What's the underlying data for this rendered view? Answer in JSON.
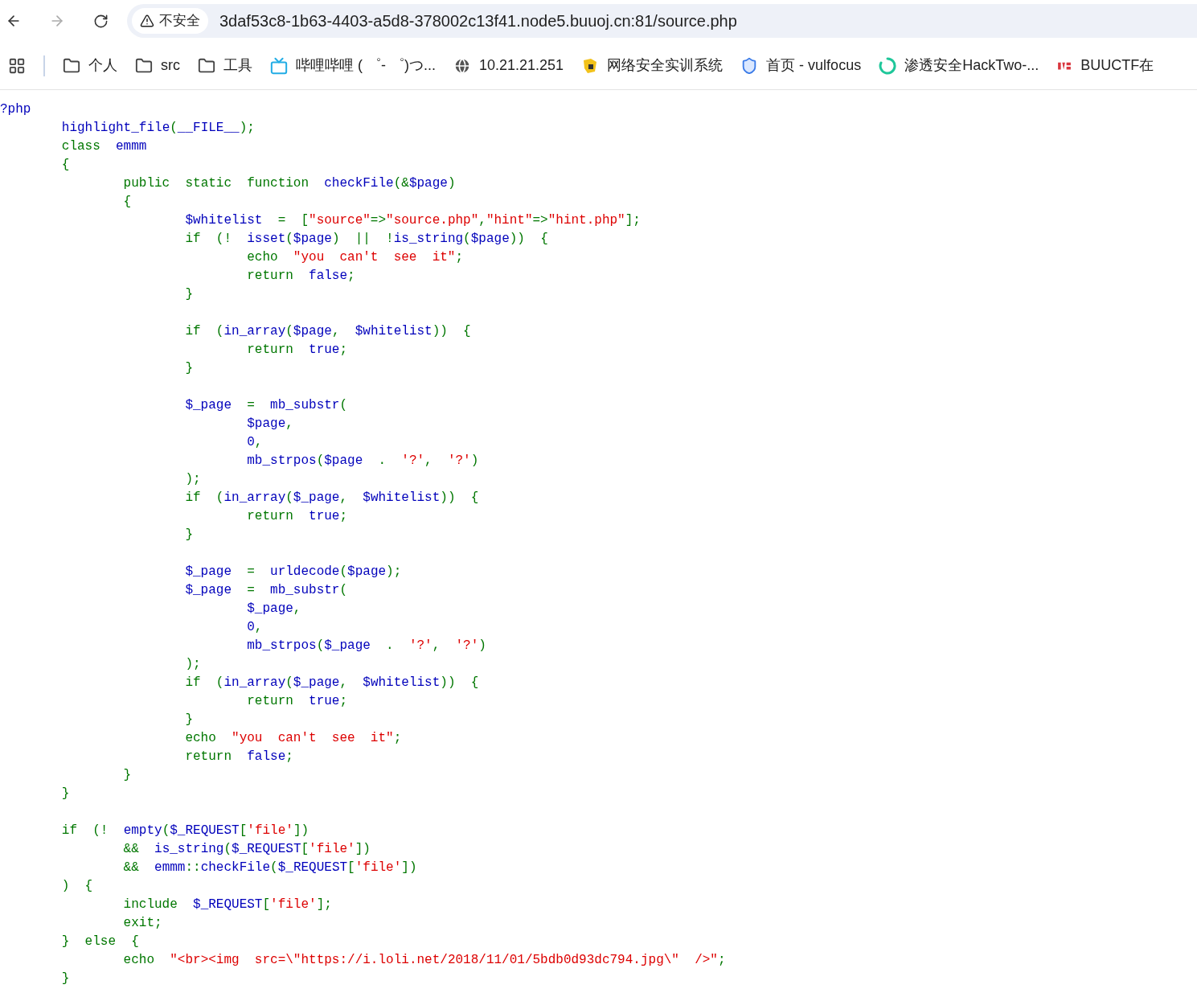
{
  "toolbar": {
    "security_label": "不安全",
    "url": "3daf53c8-1b63-4403-a5d8-378002c13f41.node5.buuoj.cn:81/source.php"
  },
  "bookmarks": [
    {
      "kind": "folder",
      "label": "个人"
    },
    {
      "kind": "folder",
      "label": "src"
    },
    {
      "kind": "folder",
      "label": "工具"
    },
    {
      "kind": "tv",
      "label": "哔哩哔哩 ( ゜- ゜)つ..."
    },
    {
      "kind": "globe",
      "label": "10.21.21.251"
    },
    {
      "kind": "badge",
      "label": "网络安全实训系统"
    },
    {
      "kind": "shield",
      "label": "首页 - vulfocus"
    },
    {
      "kind": "ring",
      "label": "渗透安全HackTwo-..."
    },
    {
      "kind": "logo",
      "label": "BUUCTF在"
    }
  ],
  "code": {
    "lines": [
      {
        "kind": "code",
        "tokens": [
          {
            "kind": "default",
            "text": "?php"
          }
        ]
      },
      {
        "kind": "code",
        "tokens": [
          {
            "kind": "default",
            "text": "    highlight_file"
          },
          {
            "kind": "keyword",
            "text": "("
          },
          {
            "kind": "default",
            "text": "__FILE__"
          },
          {
            "kind": "keyword",
            "text": ");"
          }
        ]
      },
      {
        "kind": "code",
        "tokens": [
          {
            "kind": "keyword",
            "text": "    class "
          },
          {
            "kind": "default",
            "text": "emmm"
          }
        ]
      },
      {
        "kind": "code",
        "tokens": [
          {
            "kind": "keyword",
            "text": "    {"
          }
        ]
      },
      {
        "kind": "code",
        "tokens": [
          {
            "kind": "keyword",
            "text": "        public static function "
          },
          {
            "kind": "default",
            "text": "checkFile"
          },
          {
            "kind": "keyword",
            "text": "(&"
          },
          {
            "kind": "default",
            "text": "$page"
          },
          {
            "kind": "keyword",
            "text": ")"
          }
        ]
      },
      {
        "kind": "code",
        "tokens": [
          {
            "kind": "keyword",
            "text": "        {"
          }
        ]
      },
      {
        "kind": "code",
        "tokens": [
          {
            "kind": "default",
            "text": "            $whitelist "
          },
          {
            "kind": "keyword",
            "text": "= ["
          },
          {
            "kind": "string",
            "text": "\"source\""
          },
          {
            "kind": "keyword",
            "text": "=>"
          },
          {
            "kind": "string",
            "text": "\"source.php\""
          },
          {
            "kind": "keyword",
            "text": ","
          },
          {
            "kind": "string",
            "text": "\"hint\""
          },
          {
            "kind": "keyword",
            "text": "=>"
          },
          {
            "kind": "string",
            "text": "\"hint.php\""
          },
          {
            "kind": "keyword",
            "text": "];"
          }
        ]
      },
      {
        "kind": "code",
        "tokens": [
          {
            "kind": "keyword",
            "text": "            if (! "
          },
          {
            "kind": "default",
            "text": "isset"
          },
          {
            "kind": "keyword",
            "text": "("
          },
          {
            "kind": "default",
            "text": "$page"
          },
          {
            "kind": "keyword",
            "text": ") || !"
          },
          {
            "kind": "default",
            "text": "is_string"
          },
          {
            "kind": "keyword",
            "text": "("
          },
          {
            "kind": "default",
            "text": "$page"
          },
          {
            "kind": "keyword",
            "text": ")) {"
          }
        ]
      },
      {
        "kind": "code",
        "tokens": [
          {
            "kind": "keyword",
            "text": "                echo "
          },
          {
            "kind": "string",
            "text": "\"you can't see it\""
          },
          {
            "kind": "keyword",
            "text": ";"
          }
        ]
      },
      {
        "kind": "code",
        "tokens": [
          {
            "kind": "keyword",
            "text": "                return "
          },
          {
            "kind": "default",
            "text": "false"
          },
          {
            "kind": "keyword",
            "text": ";"
          }
        ]
      },
      {
        "kind": "code",
        "tokens": [
          {
            "kind": "keyword",
            "text": "            }"
          }
        ]
      },
      {
        "kind": "blank"
      },
      {
        "kind": "code",
        "tokens": [
          {
            "kind": "keyword",
            "text": "            if ("
          },
          {
            "kind": "default",
            "text": "in_array"
          },
          {
            "kind": "keyword",
            "text": "("
          },
          {
            "kind": "default",
            "text": "$page"
          },
          {
            "kind": "keyword",
            "text": ", "
          },
          {
            "kind": "default",
            "text": "$whitelist"
          },
          {
            "kind": "keyword",
            "text": ")) {"
          }
        ]
      },
      {
        "kind": "code",
        "tokens": [
          {
            "kind": "keyword",
            "text": "                return "
          },
          {
            "kind": "default",
            "text": "true"
          },
          {
            "kind": "keyword",
            "text": ";"
          }
        ]
      },
      {
        "kind": "code",
        "tokens": [
          {
            "kind": "keyword",
            "text": "            }"
          }
        ]
      },
      {
        "kind": "blank"
      },
      {
        "kind": "code",
        "tokens": [
          {
            "kind": "default",
            "text": "            $_page "
          },
          {
            "kind": "keyword",
            "text": "= "
          },
          {
            "kind": "default",
            "text": "mb_substr"
          },
          {
            "kind": "keyword",
            "text": "("
          }
        ]
      },
      {
        "kind": "code",
        "tokens": [
          {
            "kind": "default",
            "text": "                $page"
          },
          {
            "kind": "keyword",
            "text": ","
          }
        ]
      },
      {
        "kind": "code",
        "tokens": [
          {
            "kind": "default",
            "text": "                0"
          },
          {
            "kind": "keyword",
            "text": ","
          }
        ]
      },
      {
        "kind": "code",
        "tokens": [
          {
            "kind": "default",
            "text": "                mb_strpos"
          },
          {
            "kind": "keyword",
            "text": "("
          },
          {
            "kind": "default",
            "text": "$page "
          },
          {
            "kind": "keyword",
            "text": ". "
          },
          {
            "kind": "string",
            "text": "'?'"
          },
          {
            "kind": "keyword",
            "text": ", "
          },
          {
            "kind": "string",
            "text": "'?'"
          },
          {
            "kind": "keyword",
            "text": ")"
          }
        ]
      },
      {
        "kind": "code",
        "tokens": [
          {
            "kind": "keyword",
            "text": "            );"
          }
        ]
      },
      {
        "kind": "code",
        "tokens": [
          {
            "kind": "keyword",
            "text": "            if ("
          },
          {
            "kind": "default",
            "text": "in_array"
          },
          {
            "kind": "keyword",
            "text": "("
          },
          {
            "kind": "default",
            "text": "$_page"
          },
          {
            "kind": "keyword",
            "text": ", "
          },
          {
            "kind": "default",
            "text": "$whitelist"
          },
          {
            "kind": "keyword",
            "text": ")) {"
          }
        ]
      },
      {
        "kind": "code",
        "tokens": [
          {
            "kind": "keyword",
            "text": "                return "
          },
          {
            "kind": "default",
            "text": "true"
          },
          {
            "kind": "keyword",
            "text": ";"
          }
        ]
      },
      {
        "kind": "code",
        "tokens": [
          {
            "kind": "keyword",
            "text": "            }"
          }
        ]
      },
      {
        "kind": "blank"
      },
      {
        "kind": "code",
        "tokens": [
          {
            "kind": "default",
            "text": "            $_page "
          },
          {
            "kind": "keyword",
            "text": "= "
          },
          {
            "kind": "default",
            "text": "urldecode"
          },
          {
            "kind": "keyword",
            "text": "("
          },
          {
            "kind": "default",
            "text": "$page"
          },
          {
            "kind": "keyword",
            "text": ");"
          }
        ]
      },
      {
        "kind": "code",
        "tokens": [
          {
            "kind": "default",
            "text": "            $_page "
          },
          {
            "kind": "keyword",
            "text": "= "
          },
          {
            "kind": "default",
            "text": "mb_substr"
          },
          {
            "kind": "keyword",
            "text": "("
          }
        ]
      },
      {
        "kind": "code",
        "tokens": [
          {
            "kind": "default",
            "text": "                $_page"
          },
          {
            "kind": "keyword",
            "text": ","
          }
        ]
      },
      {
        "kind": "code",
        "tokens": [
          {
            "kind": "default",
            "text": "                0"
          },
          {
            "kind": "keyword",
            "text": ","
          }
        ]
      },
      {
        "kind": "code",
        "tokens": [
          {
            "kind": "default",
            "text": "                mb_strpos"
          },
          {
            "kind": "keyword",
            "text": "("
          },
          {
            "kind": "default",
            "text": "$_page "
          },
          {
            "kind": "keyword",
            "text": ". "
          },
          {
            "kind": "string",
            "text": "'?'"
          },
          {
            "kind": "keyword",
            "text": ", "
          },
          {
            "kind": "string",
            "text": "'?'"
          },
          {
            "kind": "keyword",
            "text": ")"
          }
        ]
      },
      {
        "kind": "code",
        "tokens": [
          {
            "kind": "keyword",
            "text": "            );"
          }
        ]
      },
      {
        "kind": "code",
        "tokens": [
          {
            "kind": "keyword",
            "text": "            if ("
          },
          {
            "kind": "default",
            "text": "in_array"
          },
          {
            "kind": "keyword",
            "text": "("
          },
          {
            "kind": "default",
            "text": "$_page"
          },
          {
            "kind": "keyword",
            "text": ", "
          },
          {
            "kind": "default",
            "text": "$whitelist"
          },
          {
            "kind": "keyword",
            "text": ")) {"
          }
        ]
      },
      {
        "kind": "code",
        "tokens": [
          {
            "kind": "keyword",
            "text": "                return "
          },
          {
            "kind": "default",
            "text": "true"
          },
          {
            "kind": "keyword",
            "text": ";"
          }
        ]
      },
      {
        "kind": "code",
        "tokens": [
          {
            "kind": "keyword",
            "text": "            }"
          }
        ]
      },
      {
        "kind": "code",
        "tokens": [
          {
            "kind": "keyword",
            "text": "            echo "
          },
          {
            "kind": "string",
            "text": "\"you can't see it\""
          },
          {
            "kind": "keyword",
            "text": ";"
          }
        ]
      },
      {
        "kind": "code",
        "tokens": [
          {
            "kind": "keyword",
            "text": "            return "
          },
          {
            "kind": "default",
            "text": "false"
          },
          {
            "kind": "keyword",
            "text": ";"
          }
        ]
      },
      {
        "kind": "code",
        "tokens": [
          {
            "kind": "keyword",
            "text": "        }"
          }
        ]
      },
      {
        "kind": "code",
        "tokens": [
          {
            "kind": "keyword",
            "text": "    }"
          }
        ]
      },
      {
        "kind": "blank"
      },
      {
        "kind": "code",
        "tokens": [
          {
            "kind": "keyword",
            "text": "    if (! "
          },
          {
            "kind": "default",
            "text": "empty"
          },
          {
            "kind": "keyword",
            "text": "("
          },
          {
            "kind": "default",
            "text": "$_REQUEST"
          },
          {
            "kind": "keyword",
            "text": "["
          },
          {
            "kind": "string",
            "text": "'file'"
          },
          {
            "kind": "keyword",
            "text": "])"
          }
        ]
      },
      {
        "kind": "code",
        "tokens": [
          {
            "kind": "keyword",
            "text": "        && "
          },
          {
            "kind": "default",
            "text": "is_string"
          },
          {
            "kind": "keyword",
            "text": "("
          },
          {
            "kind": "default",
            "text": "$_REQUEST"
          },
          {
            "kind": "keyword",
            "text": "["
          },
          {
            "kind": "string",
            "text": "'file'"
          },
          {
            "kind": "keyword",
            "text": "])"
          }
        ]
      },
      {
        "kind": "code",
        "tokens": [
          {
            "kind": "keyword",
            "text": "        && "
          },
          {
            "kind": "default",
            "text": "emmm"
          },
          {
            "kind": "keyword",
            "text": "::"
          },
          {
            "kind": "default",
            "text": "checkFile"
          },
          {
            "kind": "keyword",
            "text": "("
          },
          {
            "kind": "default",
            "text": "$_REQUEST"
          },
          {
            "kind": "keyword",
            "text": "["
          },
          {
            "kind": "string",
            "text": "'file'"
          },
          {
            "kind": "keyword",
            "text": "])"
          }
        ]
      },
      {
        "kind": "code",
        "tokens": [
          {
            "kind": "keyword",
            "text": "    ) {"
          }
        ]
      },
      {
        "kind": "code",
        "tokens": [
          {
            "kind": "keyword",
            "text": "        include "
          },
          {
            "kind": "default",
            "text": "$_REQUEST"
          },
          {
            "kind": "keyword",
            "text": "["
          },
          {
            "kind": "string",
            "text": "'file'"
          },
          {
            "kind": "keyword",
            "text": "];"
          }
        ]
      },
      {
        "kind": "code",
        "tokens": [
          {
            "kind": "keyword",
            "text": "        exit;"
          }
        ]
      },
      {
        "kind": "code",
        "tokens": [
          {
            "kind": "keyword",
            "text": "    } else {"
          }
        ]
      },
      {
        "kind": "code",
        "tokens": [
          {
            "kind": "keyword",
            "text": "        echo "
          },
          {
            "kind": "string",
            "text": "\"<br><img src=\\\"https://i.loli.net/2018/11/01/5bdb0d93dc794.jpg\\\" />\""
          },
          {
            "kind": "keyword",
            "text": ";"
          }
        ]
      },
      {
        "kind": "code",
        "tokens": [
          {
            "kind": "keyword",
            "text": "    }"
          }
        ]
      }
    ]
  }
}
